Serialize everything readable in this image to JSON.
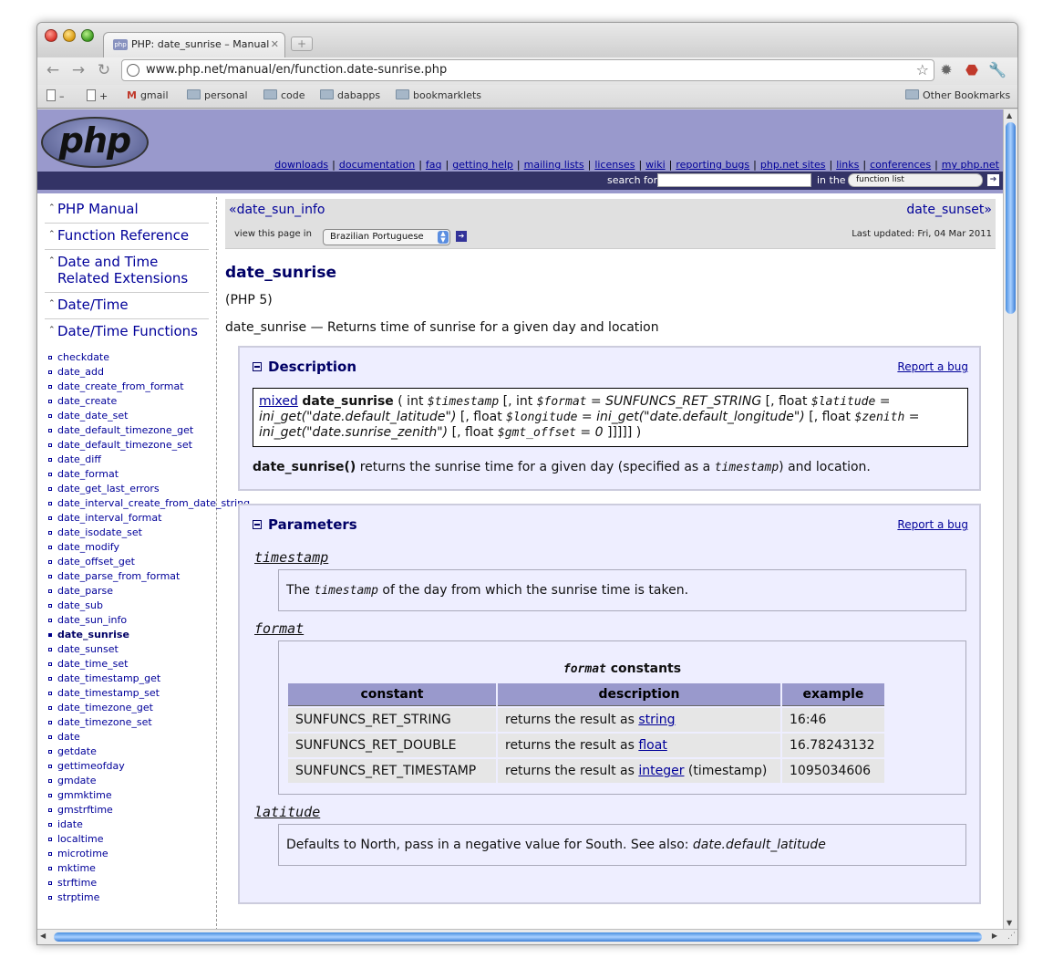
{
  "browser": {
    "tab_title": "PHP: date_sunrise – Manual",
    "tab_favicon": "php",
    "url": "www.php.net/manual/en/function.date-sunrise.php",
    "bookmarks": [
      "gmail",
      "personal",
      "code",
      "dabapps",
      "bookmarklets"
    ],
    "other_bookmarks": "Other Bookmarks"
  },
  "header": {
    "logo": "php",
    "nav": [
      "downloads",
      "documentation",
      "faq",
      "getting help",
      "mailing lists",
      "licenses",
      "wiki",
      "reporting bugs",
      "php.net sites",
      "links",
      "conferences",
      "my php.net"
    ],
    "search_label": "search for",
    "in_the_label": "in the",
    "search_scope": "function list"
  },
  "sidebar": {
    "headings": [
      "PHP Manual",
      "Function Reference",
      "Date and Time Related Extensions",
      "Date/Time",
      "Date/Time Functions"
    ],
    "items": [
      "checkdate",
      "date_add",
      "date_create_from_format",
      "date_create",
      "date_date_set",
      "date_default_timezone_get",
      "date_default_timezone_set",
      "date_diff",
      "date_format",
      "date_get_last_errors",
      "date_interval_create_from_date_string",
      "date_interval_format",
      "date_isodate_set",
      "date_modify",
      "date_offset_get",
      "date_parse_from_format",
      "date_parse",
      "date_sub",
      "date_sun_info",
      "date_sunrise",
      "date_sunset",
      "date_time_set",
      "date_timestamp_get",
      "date_timestamp_set",
      "date_timezone_get",
      "date_timezone_set",
      "date",
      "getdate",
      "gettimeofday",
      "gmdate",
      "gmmktime",
      "gmstrftime",
      "idate",
      "localtime",
      "microtime",
      "mktime",
      "strftime",
      "strptime"
    ],
    "active": "date_sunrise"
  },
  "content": {
    "prev": "date_sun_info",
    "next": "date_sunset",
    "view_in_label": "view this page in",
    "language": "Brazilian Portuguese",
    "last_updated": "Last updated: Fri, 04 Mar 2011",
    "title": "date_sunrise",
    "version": "(PHP 5)",
    "purpose": "date_sunrise — Returns time of sunrise for a given day and location",
    "description": {
      "title": "Description",
      "report_bug": "Report a bug",
      "return_type": "mixed",
      "fn": "date_sunrise",
      "synopsis": [
        {
          "t": " ( int ",
          "s": "n"
        },
        {
          "t": "$timestamp",
          "s": "v"
        },
        {
          "t": " [, int ",
          "s": "n"
        },
        {
          "t": "$format",
          "s": "v"
        },
        {
          "t": " = ",
          "s": "n"
        },
        {
          "t": "SUNFUNCS_RET_STRING",
          "s": "i"
        },
        {
          "t": " [, float ",
          "s": "n"
        },
        {
          "t": "$latitude",
          "s": "v"
        },
        {
          "t": " = ",
          "s": "n"
        },
        {
          "t": "ini_get(\"date.default_latitude\")",
          "s": "i"
        },
        {
          "t": " [, float ",
          "s": "n"
        },
        {
          "t": "$longitude",
          "s": "v"
        },
        {
          "t": " = ",
          "s": "n"
        },
        {
          "t": "ini_get(\"date.default_longitude\")",
          "s": "i"
        },
        {
          "t": " [, float ",
          "s": "n"
        },
        {
          "t": "$zenith",
          "s": "v"
        },
        {
          "t": " = ",
          "s": "n"
        },
        {
          "t": "ini_get(\"date.sunrise_zenith\")",
          "s": "i"
        },
        {
          "t": " [, float ",
          "s": "n"
        },
        {
          "t": "$gmt_offset",
          "s": "v"
        },
        {
          "t": " = ",
          "s": "n"
        },
        {
          "t": "0",
          "s": "i"
        },
        {
          "t": " ]]]]] )",
          "s": "n"
        }
      ],
      "text_fn": "date_sunrise()",
      "text_before": " returns the sunrise time for a given day (specified as a ",
      "text_param": "timestamp",
      "text_after": ") and location."
    },
    "parameters": {
      "title": "Parameters",
      "report_bug": "Report a bug",
      "timestamp": {
        "term": "timestamp",
        "text_before": "The ",
        "text_param": "timestamp",
        "text_after": " of the day from which the sunrise time is taken."
      },
      "format": {
        "term": "format",
        "caption_param": "format",
        "caption_text": " constants",
        "headers": [
          "constant",
          "description",
          "example"
        ],
        "rows": [
          {
            "constant": "SUNFUNCS_RET_STRING",
            "desc": "returns the result as ",
            "link": "string",
            "suffix": "",
            "example": "16:46"
          },
          {
            "constant": "SUNFUNCS_RET_DOUBLE",
            "desc": "returns the result as ",
            "link": "float",
            "suffix": "",
            "example": "16.78243132"
          },
          {
            "constant": "SUNFUNCS_RET_TIMESTAMP",
            "desc": "returns the result as ",
            "link": "integer",
            "suffix": " (timestamp)",
            "example": "1095034606"
          }
        ]
      },
      "latitude": {
        "term": "latitude",
        "text": "Defaults to North, pass in a negative value for South. See also: ",
        "link": "date.default_latitude"
      }
    }
  }
}
